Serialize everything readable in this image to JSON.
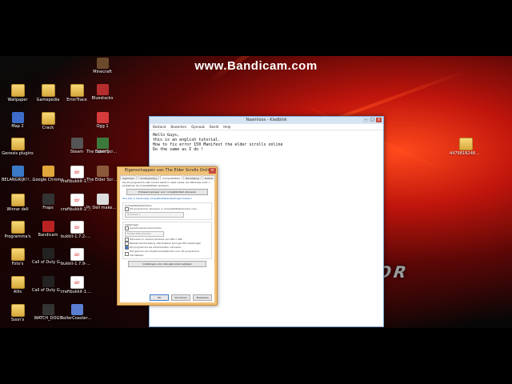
{
  "watermark": "www.Bandicam.com",
  "desktop_icons": [
    {
      "label": "Minecraft",
      "type": "app",
      "color": "#6b4a2b"
    },
    {
      "label": "Bluestacks",
      "type": "app",
      "color": "#b52d2d"
    },
    {
      "label": "Wallpaper",
      "type": "folder"
    },
    {
      "label": "Gamepedia",
      "type": "folder"
    },
    {
      "label": "ErrorTrace",
      "type": "folder"
    },
    {
      "label": "Map 2",
      "type": "app",
      "color": "#3d6dc9"
    },
    {
      "label": "Ogg 1",
      "type": "app",
      "color": "#d63b3b"
    },
    {
      "label": "Crack",
      "type": "folder"
    },
    {
      "label": "Spotify",
      "type": "app",
      "color": "#f3e63b"
    },
    {
      "label": "Genesis plugins",
      "type": "folder"
    },
    {
      "label": "Steam",
      "type": "app",
      "color": "#555"
    },
    {
      "label": "The Elder Scrolls Online",
      "type": "app",
      "color": "#3c7a3c"
    },
    {
      "label": "BELANGRIJK!!!!!",
      "type": "app",
      "color": "#3a79c6"
    },
    {
      "label": "Google Chrome",
      "type": "app",
      "color": "#e0a73b"
    },
    {
      "label": "craftbukkit-1.7.2-R...",
      "type": "java"
    },
    {
      "label": "The Elder Scrolls Online",
      "type": "app",
      "color": "#8b5a3a"
    },
    {
      "label": "Winrar dell",
      "type": "folder"
    },
    {
      "label": "Fraps",
      "type": "app",
      "color": "#333"
    },
    {
      "label": "craftbukkit-1.7.2-R...",
      "type": "java"
    },
    {
      "label": "Pc Dell maken op fijn",
      "type": "app",
      "color": "#ddd"
    },
    {
      "label": "Programma's",
      "type": "folder"
    },
    {
      "label": "Bandicam",
      "type": "app",
      "color": "#b22"
    },
    {
      "label": "bukkit-1.7.2-R0.1",
      "type": "java"
    },
    {
      "label": "Foto's",
      "type": "folder"
    },
    {
      "label": "Call of Duty Ghosts - Multiplayer",
      "type": "app",
      "color": "#222"
    },
    {
      "label": "bukkit-1.7.9-R0.1",
      "type": "java"
    },
    {
      "label": "Allis",
      "type": "folder"
    },
    {
      "label": "Call of Duty Ghosts",
      "type": "app",
      "color": "#222"
    },
    {
      "label": "craftbukkit-1.7.9-R...",
      "type": "java"
    },
    {
      "label": "Soon's",
      "type": "folder"
    },
    {
      "label": "WATCH_DOGS",
      "type": "app",
      "color": "#333"
    },
    {
      "label": "RollerCoaster Tycoon 3",
      "type": "app",
      "color": "#5a7fd0"
    },
    {
      "label": "447981B2480B7...",
      "type": "folder"
    }
  ],
  "notepad": {
    "title": "Naamloos - Kladblok",
    "menu": [
      "Bestand",
      "Bewerken",
      "Opmaak",
      "Beeld",
      "Help"
    ],
    "text": "Hello Guys,\nthis is an english tutorial.\nHow to fix error 150 Manifest the elder scrolls online\nDo the same as I do !"
  },
  "dialog": {
    "title": "Eigenschappen van The Elder Scrolls Online",
    "tabs": [
      "Algemeen",
      "Snelkoppeling",
      "Compatibiliteit",
      "Beveiliging",
      "Details"
    ],
    "intro": "Als dit programma niet correct werkt in deze versie van Windows, kunt u problemen bij compatibiliteit oplossen.",
    "troubleshoot_button": "Probleemoplosser voor compatibiliteit uitvoeren",
    "help_link": "Hoe kan ik handmatig compatibiliteitsinstellingen kiezen?",
    "compat_group": "Compatibiliteitsmodus",
    "compat_check": "Dit programma uitvoeren in compatibiliteitsmodus voor:",
    "compat_os": "Windows 7",
    "settings_group": "Instellingen",
    "settings": [
      {
        "label": "Gereduceerde kleurmodus",
        "checked": false
      },
      {
        "label": "Uitvoeren in schermresolutie van 640 x 480",
        "checked": false
      },
      {
        "label": "Beeldschermschaling uitschakelen bij hoge DPI-instellingen",
        "checked": false
      },
      {
        "label": "Dit programma als administrator uitvoeren",
        "checked": true
      },
      {
        "label": "Het gebruik van OneDrive-bestanden voor dit programma inschakelen",
        "checked": false
      }
    ],
    "color_select": "8-bits (256) kleuren",
    "all_users_button": "Instellingen voor alle gebruikers wijzigen",
    "ok_button": "OK",
    "cancel_button": "Annuleren",
    "apply_button": "Toepassen"
  }
}
